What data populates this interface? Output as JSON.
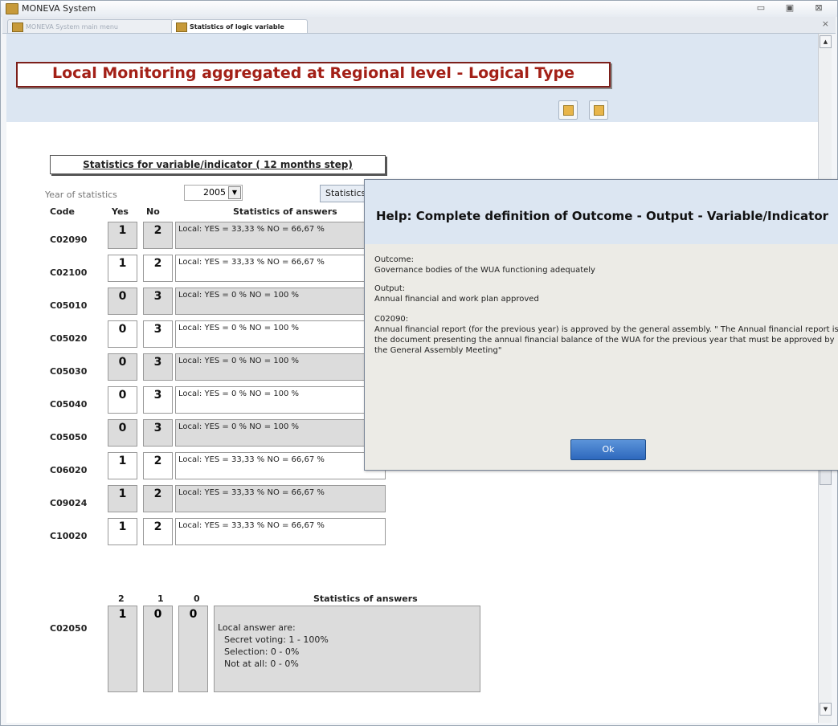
{
  "window": {
    "title": "MONEVA System",
    "close_tab": "×"
  },
  "tabs": [
    {
      "label": "MONEVA System main menu"
    },
    {
      "label": "Statistics of logic variable"
    }
  ],
  "form": {
    "title": "Local Monitoring aggregated at Regional level - Logical Type",
    "section_title": "Statistics for variable/indicator ( 12 months step)",
    "year_label": "Year of statistics",
    "year_value": "2005",
    "stats_button": "Statistics",
    "columns": {
      "code": "Code",
      "yes": "Yes",
      "no": "No",
      "stats": "Statistics of answers"
    },
    "rows": [
      {
        "code": "C02090",
        "yes": "1",
        "no": "2",
        "stat": "Local:  YES = 33,33 %    NO = 66,67 %"
      },
      {
        "code": "C02100",
        "yes": "1",
        "no": "2",
        "stat": "Local:  YES = 33,33 %    NO = 66,67 %"
      },
      {
        "code": "C05010",
        "yes": "0",
        "no": "3",
        "stat": "Local:  YES = 0 %    NO = 100 %"
      },
      {
        "code": "C05020",
        "yes": "0",
        "no": "3",
        "stat": "Local:  YES = 0 %    NO = 100 %"
      },
      {
        "code": "C05030",
        "yes": "0",
        "no": "3",
        "stat": "Local:  YES = 0 %    NO = 100 %"
      },
      {
        "code": "C05040",
        "yes": "0",
        "no": "3",
        "stat": "Local:  YES = 0 %    NO = 100 %"
      },
      {
        "code": "C05050",
        "yes": "0",
        "no": "3",
        "stat": "Local:  YES = 0 %    NO = 100 %"
      },
      {
        "code": "C06020",
        "yes": "1",
        "no": "2",
        "stat": "Local:  YES = 33,33 %    NO = 66,67 %"
      },
      {
        "code": "C09024",
        "yes": "1",
        "no": "2",
        "stat": "Local:  YES = 33,33 %    NO = 66,67 %"
      },
      {
        "code": "C10020",
        "yes": "1",
        "no": "2",
        "stat": "Local:  YES = 33,33 %    NO = 66,67 %"
      }
    ],
    "bottom": {
      "col_2": "2",
      "col_1": "1",
      "col_0": "0",
      "stats_header": "Statistics of answers",
      "code": "C02050",
      "v2": "1",
      "v1": "0",
      "v0": "0",
      "lines": [
        "Local answer are:",
        "Secret voting: 1 - 100%",
        "Selection: 0 - 0%",
        "Not at all: 0 - 0%"
      ]
    }
  },
  "dialog": {
    "title": "Help: Complete definition of Outcome - Output - Variable/Indicator",
    "outcome_label": "Outcome:",
    "outcome_text": "Governance bodies of the WUA functioning adequately",
    "output_label": "Output:",
    "output_text": "Annual financial and work plan approved",
    "code_label": "C02090:",
    "code_text": "Annual financial report (for the previous year) is approved by the general assembly. \" The Annual financial report is the document presenting the annual financial balance of the WUA for the previous year that must be approved by the General Assembly Meeting\"",
    "ok": "Ok"
  },
  "colors": {
    "accent": "#a32017",
    "band": "#dce6f2",
    "row_gray": "#dcdcdc"
  }
}
